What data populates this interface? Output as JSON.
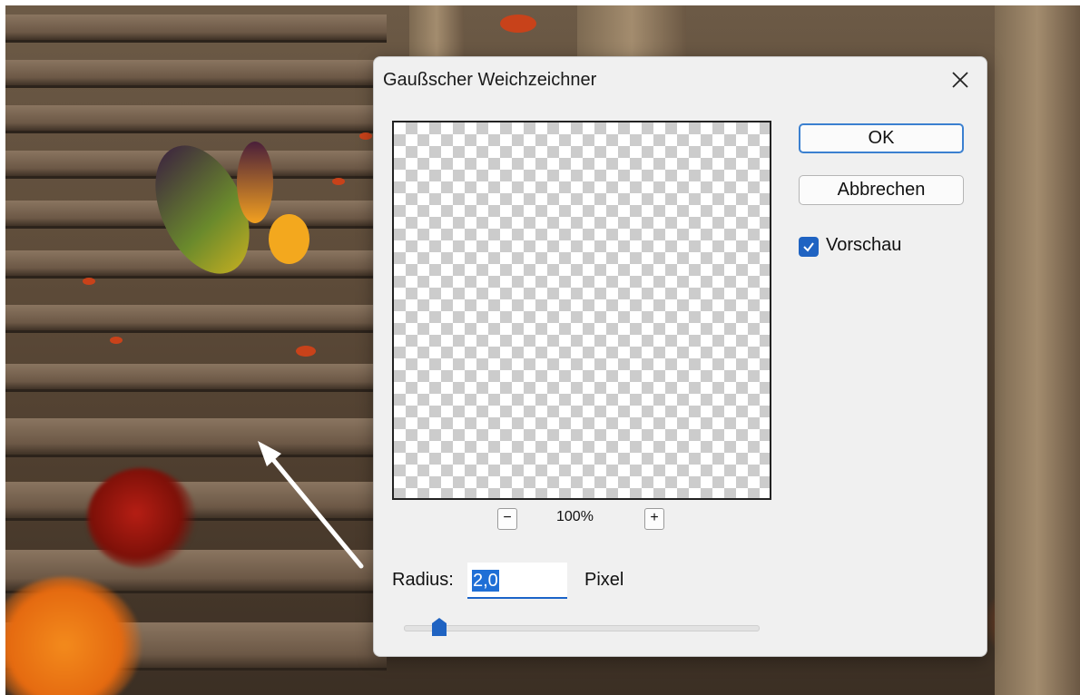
{
  "dialog": {
    "title": "Gaußscher Weichzeichner",
    "close_icon": "close-icon",
    "ok_label": "OK",
    "cancel_label": "Abbrechen",
    "preview_checkbox": {
      "label": "Vorschau",
      "checked": true
    },
    "zoom": {
      "minus": "−",
      "plus": "+",
      "level": "100%"
    },
    "radius": {
      "label": "Radius:",
      "value": "2,0",
      "unit": "Pixel",
      "slider_fraction": 0.1
    }
  },
  "colors": {
    "accent": "#1f63c2",
    "dialog_bg": "#f0f0f0"
  }
}
